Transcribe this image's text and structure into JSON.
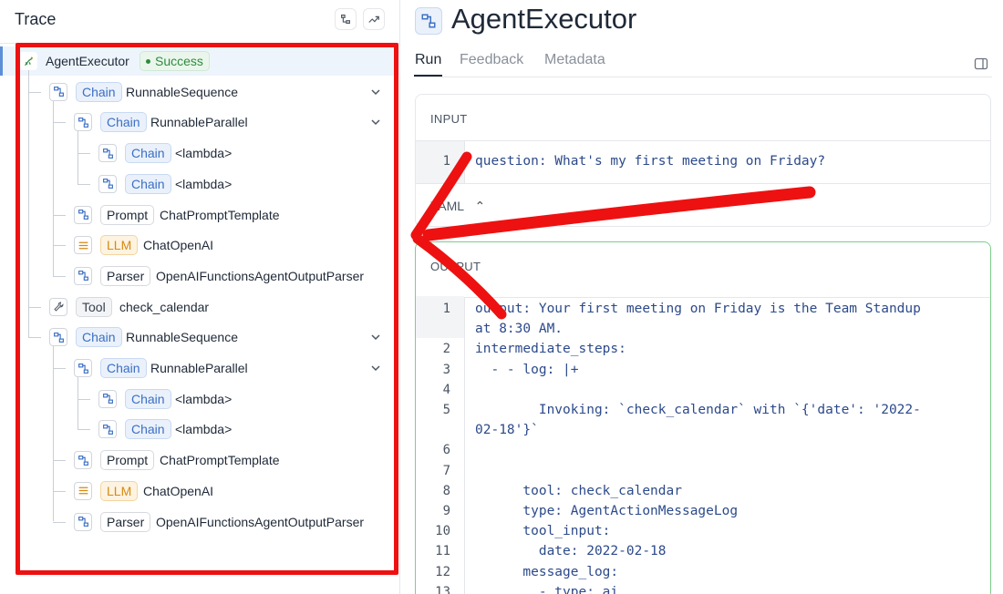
{
  "trace": {
    "title": "Trace",
    "rows": [
      {
        "badge": "",
        "name": "AgentExecutor",
        "status": "Success",
        "kind": "root"
      },
      {
        "badge": "Chain",
        "name": "RunnableSequence",
        "kind": "chain"
      },
      {
        "badge": "Chain",
        "name": "RunnableParallel",
        "kind": "chain"
      },
      {
        "badge": "Chain",
        "name": "<lambda>",
        "kind": "chain"
      },
      {
        "badge": "Chain",
        "name": "<lambda>",
        "kind": "chain"
      },
      {
        "badge": "Prompt",
        "name": "ChatPromptTemplate",
        "kind": "prompt"
      },
      {
        "badge": "LLM",
        "name": "ChatOpenAI",
        "kind": "llm"
      },
      {
        "badge": "Parser",
        "name": "OpenAIFunctionsAgentOutputParser",
        "kind": "parser"
      },
      {
        "badge": "Tool",
        "name": "check_calendar",
        "kind": "tool"
      },
      {
        "badge": "Chain",
        "name": "RunnableSequence",
        "kind": "chain"
      },
      {
        "badge": "Chain",
        "name": "RunnableParallel",
        "kind": "chain"
      },
      {
        "badge": "Chain",
        "name": "<lambda>",
        "kind": "chain"
      },
      {
        "badge": "Chain",
        "name": "<lambda>",
        "kind": "chain"
      },
      {
        "badge": "Prompt",
        "name": "ChatPromptTemplate",
        "kind": "prompt"
      },
      {
        "badge": "LLM",
        "name": "ChatOpenAI",
        "kind": "llm"
      },
      {
        "badge": "Parser",
        "name": "OpenAIFunctionsAgentOutputParser",
        "kind": "parser"
      }
    ]
  },
  "detail": {
    "title": "AgentExecutor",
    "tabs": [
      "Run",
      "Feedback",
      "Metadata"
    ],
    "active_tab": "Run",
    "input": {
      "label": "INPUT",
      "lines": [
        {
          "n": "1",
          "text": "question: What's my first meeting on Friday?"
        }
      ],
      "format": "YAML"
    },
    "output": {
      "label": "OUTPUT",
      "lines": [
        {
          "n": "1",
          "text": "output: Your first meeting on Friday is the Team Standup"
        },
        {
          "n": "",
          "text": "at 8:30 AM."
        },
        {
          "n": "2",
          "text": "intermediate_steps:"
        },
        {
          "n": "3",
          "text": "  - - log: |+"
        },
        {
          "n": "4",
          "text": ""
        },
        {
          "n": "5",
          "text": "        Invoking: `check_calendar` with `{'date': '2022-"
        },
        {
          "n": "",
          "text": "02-18'}`"
        },
        {
          "n": "6",
          "text": ""
        },
        {
          "n": "7",
          "text": ""
        },
        {
          "n": "8",
          "text": "      tool: check_calendar"
        },
        {
          "n": "9",
          "text": "      type: AgentActionMessageLog"
        },
        {
          "n": "10",
          "text": "      tool_input:"
        },
        {
          "n": "11",
          "text": "        date: 2022-02-18"
        },
        {
          "n": "12",
          "text": "      message_log:"
        },
        {
          "n": "13",
          "text": "        - type: ai"
        }
      ]
    }
  },
  "colors": {
    "annotation_red": "#ee1111",
    "chain_blue": "#3b6fc4",
    "llm_orange": "#d48a14",
    "success_green": "#2e8b3e"
  }
}
